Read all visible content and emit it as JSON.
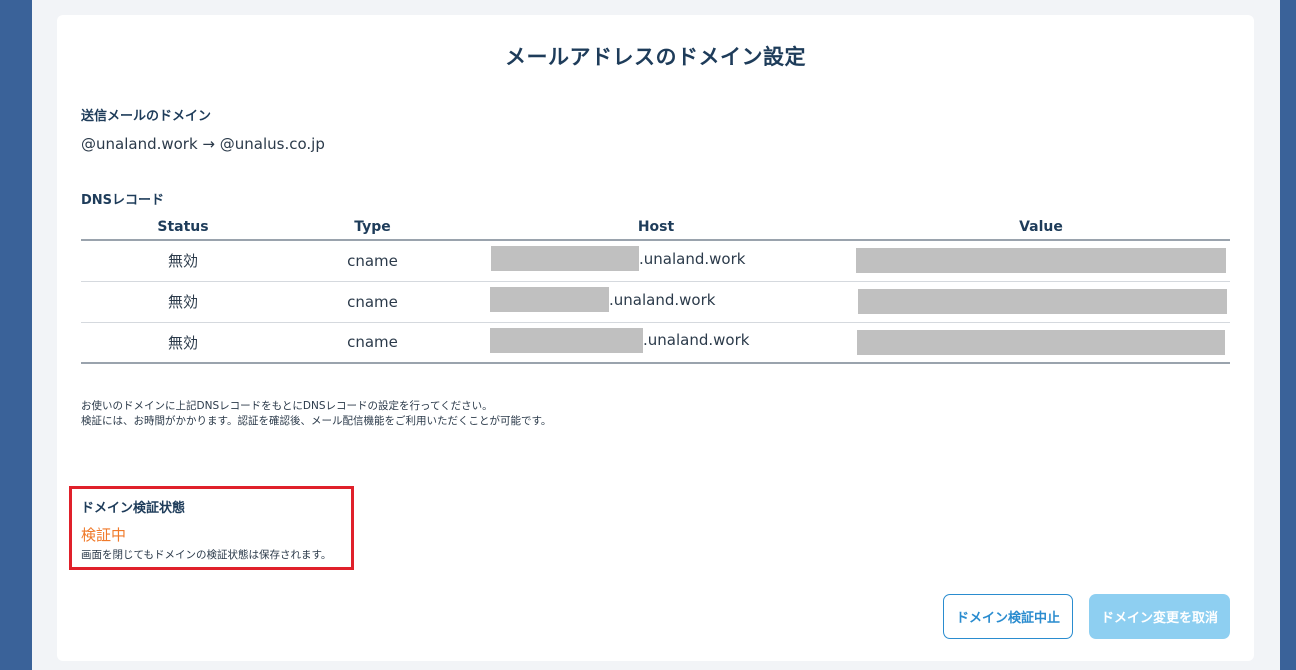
{
  "page_title": "メールアドレスのドメイン設定",
  "sending_domain": {
    "label": "送信メールのドメイン",
    "value": "@unaland.work → @unalus.co.jp"
  },
  "dns": {
    "label": "DNSレコード",
    "columns": [
      "Status",
      "Type",
      "Host",
      "Value"
    ],
    "rows": [
      {
        "status": "無効",
        "type": "cname",
        "host_suffix": ".unaland.work"
      },
      {
        "status": "無効",
        "type": "cname",
        "host_suffix": ".unaland.work"
      },
      {
        "status": "無効",
        "type": "cname",
        "host_suffix": ".unaland.work"
      }
    ]
  },
  "note": {
    "line1": "お使いのドメインに上記DNSレコードをもとにDNSレコードの設定を行ってください。",
    "line2": "検証には、お時間がかかります。認証を確認後、メール配信機能をご利用いただくことが可能です。"
  },
  "verification": {
    "label": "ドメイン検証状態",
    "status": "検証中",
    "note": "画面を閉じてもドメインの検証状態は保存されます。"
  },
  "buttons": {
    "stop": "ドメイン検証中止",
    "cancel": "ドメイン変更を取消"
  },
  "colors": {
    "frame": "#3a6299",
    "title": "#1e3c5a",
    "status_pending": "#f07a2a",
    "highlight_border": "#e0202a",
    "primary": "#2a8ccf",
    "disabled_button": "#8ecff1"
  }
}
